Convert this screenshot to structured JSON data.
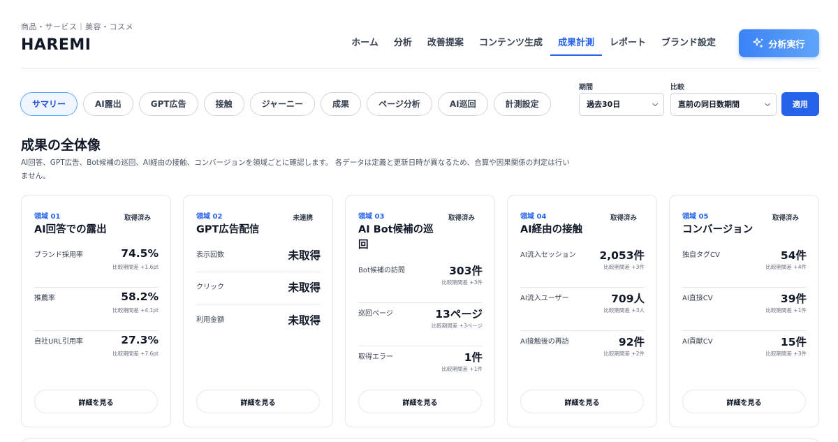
{
  "header": {
    "subtitle": "商品・サービス｜美容・コスメ",
    "title": "HAREMI",
    "nav": [
      "ホーム",
      "分析",
      "改善提案",
      "コンテンツ生成",
      "成果計測",
      "レポート",
      "ブランド設定"
    ],
    "active_nav": 4,
    "run_button": "分析実行",
    "run_icon": "sparkle-icon"
  },
  "tabs": {
    "items": [
      "サマリー",
      "AI露出",
      "GPT広告",
      "接触",
      "ジャーニー",
      "成果",
      "ページ分析",
      "AI巡回",
      "計測設定"
    ],
    "active": 0
  },
  "filters": {
    "period_label": "期間",
    "period_value": "過去30日",
    "compare_label": "比較",
    "compare_value": "直前の同日数期間",
    "apply": "適用"
  },
  "section": {
    "title": "成果の全体像",
    "description": "AI回答、GPT広告、Bot候補の巡回、AI経由の接触、コンバージョンを領域ごとに確認します。 各データは定義と更新日時が異なるため、合算や因果関係の判定は行いません。"
  },
  "cards": [
    {
      "domain": "領域 01",
      "status": "取得済み",
      "title": "AI回答での露出",
      "metrics": [
        {
          "label": "ブランド採用率",
          "value": "74.5%",
          "delta": "比較期間差 +1.6pt"
        },
        {
          "label": "推薦率",
          "value": "58.2%",
          "delta": "比較期間差 +4.1pt"
        },
        {
          "label": "自社URL引用率",
          "value": "27.3%",
          "delta": "比較期間差 +7.6pt"
        }
      ],
      "button": "詳細を見る"
    },
    {
      "domain": "領域 02",
      "status": "未連携",
      "title": "GPT広告配信",
      "metrics": [
        {
          "label": "表示回数",
          "value": "未取得",
          "delta": ""
        },
        {
          "label": "クリック",
          "value": "未取得",
          "delta": ""
        },
        {
          "label": "利用金額",
          "value": "未取得",
          "delta": ""
        }
      ],
      "button": "詳細を見る"
    },
    {
      "domain": "領域 03",
      "status": "取得済み",
      "title": "AI Bot候補の巡回",
      "metrics": [
        {
          "label": "Bot候補の訪問",
          "value": "303件",
          "delta": "比較期間差 +3件"
        },
        {
          "label": "巡回ページ",
          "value": "13ページ",
          "delta": "比較期間差 +3ページ"
        },
        {
          "label": "取得エラー",
          "value": "1件",
          "delta": "比較期間差 +1件"
        }
      ],
      "button": "詳細を見る"
    },
    {
      "domain": "領域 04",
      "status": "取得済み",
      "title": "AI経由の接触",
      "metrics": [
        {
          "label": "AI流入セッション",
          "value": "2,053件",
          "delta": "比較期間差 +3件"
        },
        {
          "label": "AI流入ユーザー",
          "value": "709人",
          "delta": "比較期間差 +3人"
        },
        {
          "label": "AI接触後の再訪",
          "value": "92件",
          "delta": "比較期間差 +2件"
        }
      ],
      "button": "詳細を見る"
    },
    {
      "domain": "領域 05",
      "status": "取得済み",
      "title": "コンバージョン",
      "metrics": [
        {
          "label": "独自タグCV",
          "value": "54件",
          "delta": "比較期間差 +4件"
        },
        {
          "label": "AI直接CV",
          "value": "39件",
          "delta": "比較期間差 +1件"
        },
        {
          "label": "AI貢献CV",
          "value": "15件",
          "delta": "比較期間差 +3件"
        }
      ],
      "button": "詳細を見る"
    }
  ],
  "colors": {
    "accent": "#2563eb",
    "active_tab_bg": "#eff6ff",
    "border": "#e5e7eb"
  }
}
